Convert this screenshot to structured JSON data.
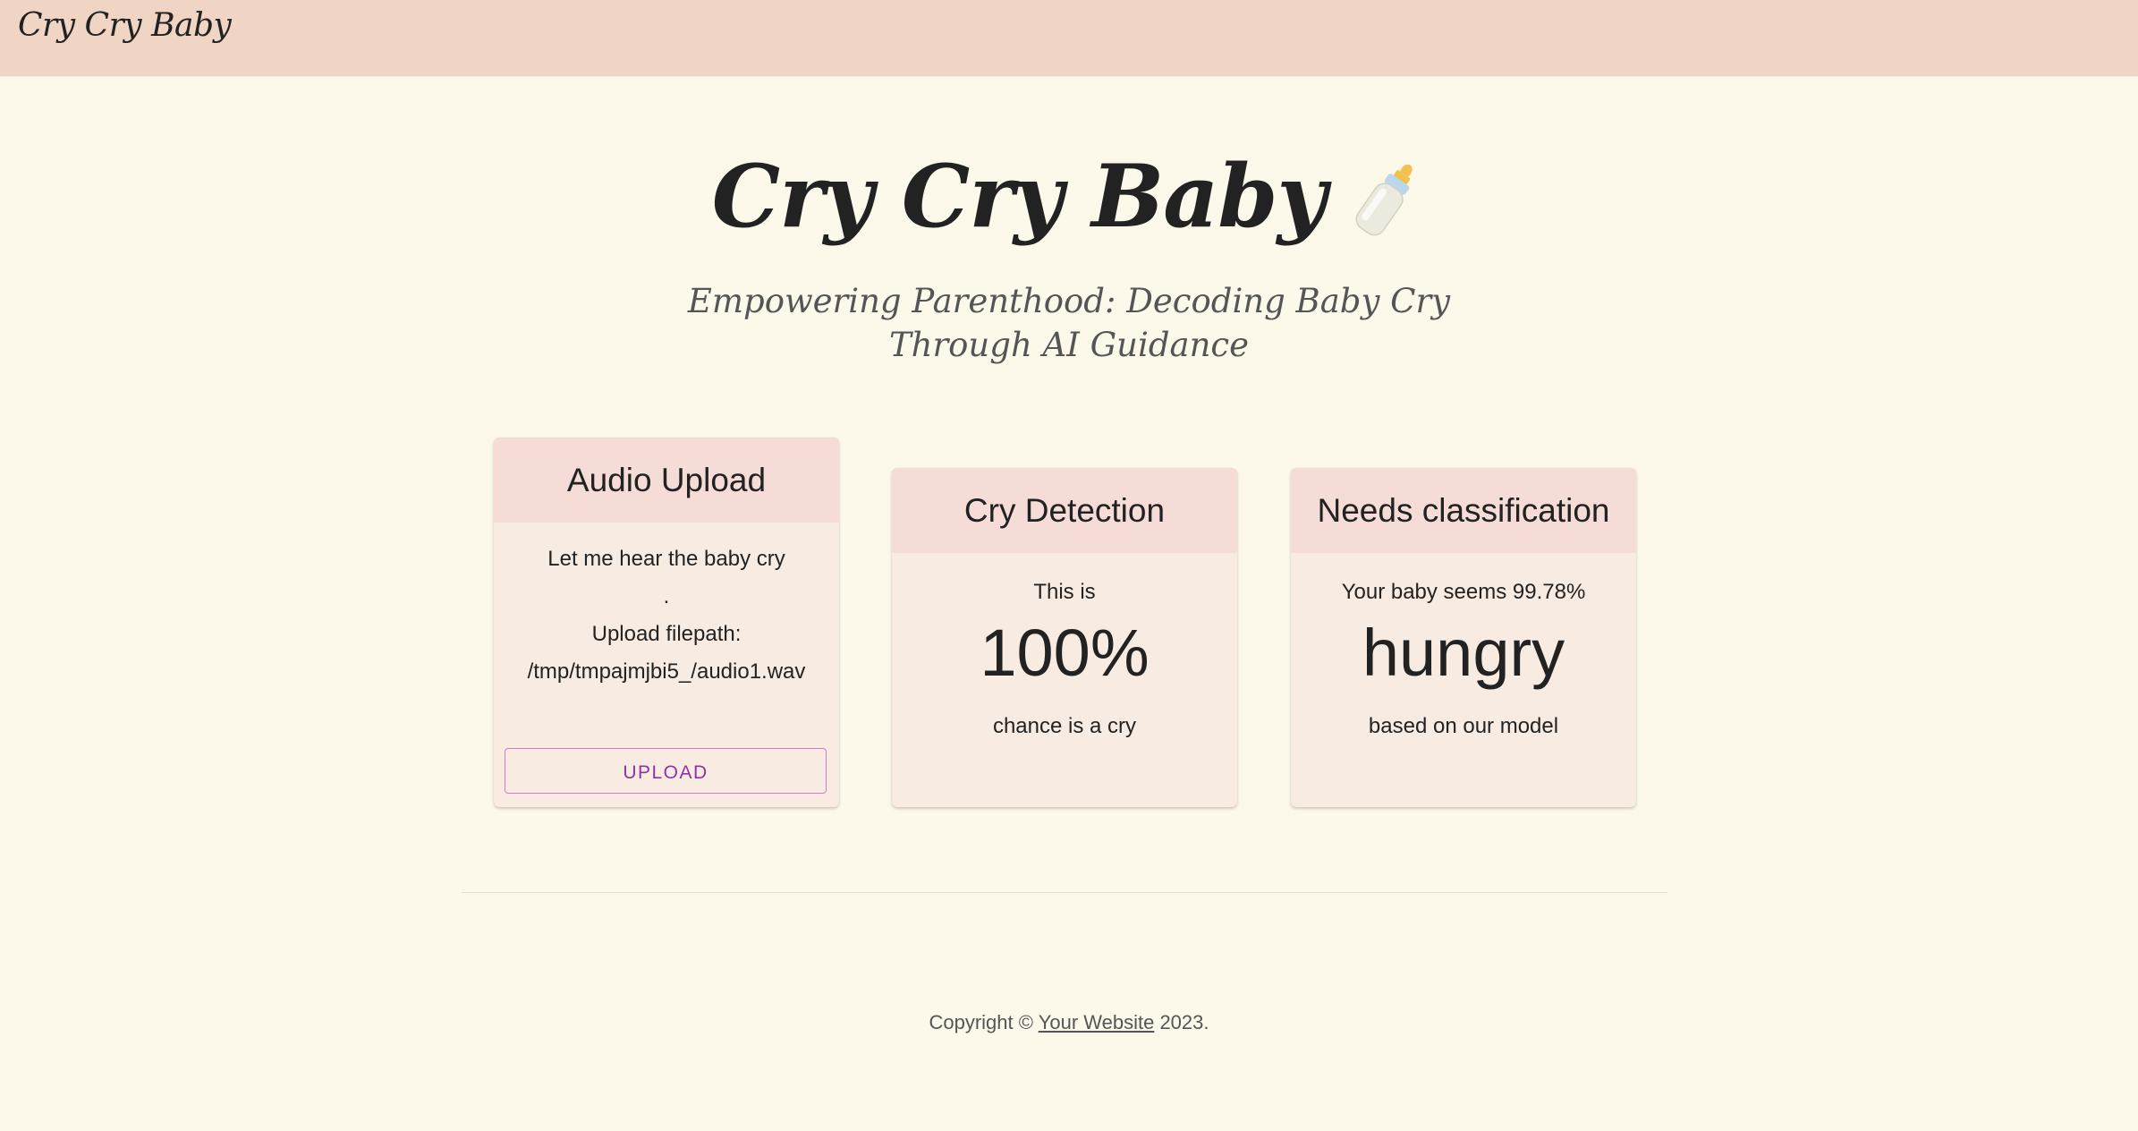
{
  "navbar": {
    "brand": "Cry Cry Baby"
  },
  "hero": {
    "title": "Cry Cry Baby",
    "title_icon": "baby-bottle-icon",
    "subtitle": "Empowering Parenthood: Decoding Baby Cry Through AI Guidance"
  },
  "cards": {
    "upload": {
      "title": "Audio Upload",
      "line1": "Let me hear the baby cry",
      "line2": ".",
      "line3": "Upload filepath:",
      "filepath": "/tmp/tmpajmjbi5_/audio1.wav",
      "button_label": "UPLOAD"
    },
    "cry_detection": {
      "title": "Cry Detection",
      "pre": "This is",
      "value": "100%",
      "post": "chance is a cry"
    },
    "needs": {
      "title": "Needs classification",
      "pre": "Your baby seems 99.78%",
      "value": "hungry",
      "post": "based on our model"
    }
  },
  "footer": {
    "prefix": "Copyright © ",
    "link_text": "Your Website",
    "suffix": " 2023."
  },
  "colors": {
    "background": "#fdf9ea",
    "navbar": "#f0d5c4",
    "card_header": "#f5dcd6",
    "card_body": "#f8ece2",
    "button_accent": "#8e33a8"
  }
}
